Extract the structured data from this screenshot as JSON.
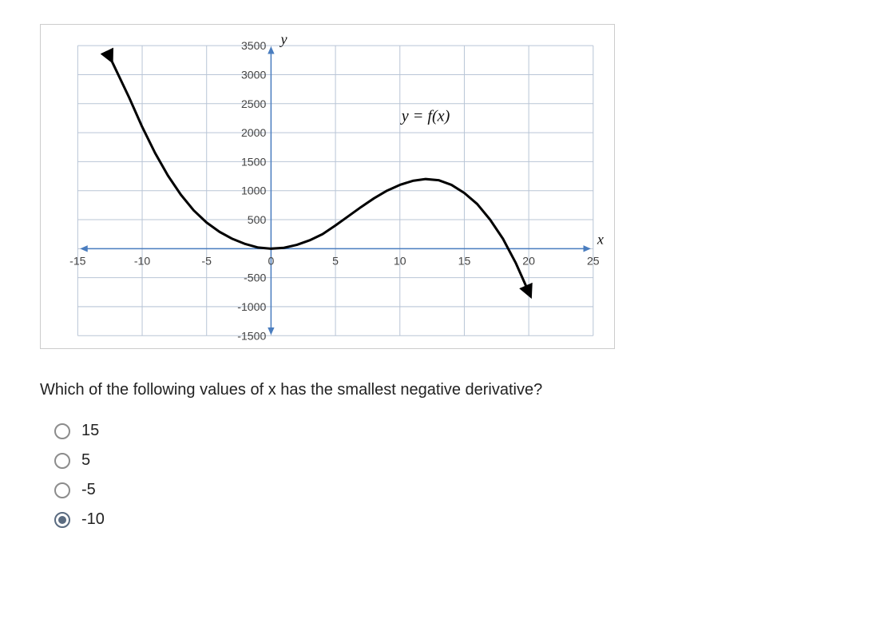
{
  "chart_data": {
    "type": "line",
    "title": "",
    "equation_label": "y = f(x)",
    "xlabel": "x",
    "ylabel": "y",
    "xlim": [
      -15,
      25
    ],
    "ylim": [
      -1500,
      3500
    ],
    "x_ticks": [
      -15,
      -10,
      -5,
      0,
      5,
      10,
      15,
      20,
      25
    ],
    "y_ticks": [
      -1500,
      -1000,
      -500,
      500,
      1000,
      1500,
      2000,
      2500,
      3000,
      3500
    ],
    "series": [
      {
        "name": "f(x)",
        "x": [
          -12.5,
          -11,
          -10,
          -9,
          -8,
          -7,
          -6,
          -5,
          -4,
          -3,
          -2,
          -1,
          0,
          1,
          2,
          3,
          4,
          5,
          6,
          7,
          8,
          9,
          10,
          11,
          12,
          13,
          14,
          15,
          16,
          17,
          18,
          19,
          20
        ],
        "values": [
          3300,
          2600,
          2100,
          1650,
          1260,
          930,
          660,
          450,
          290,
          170,
          80,
          20,
          0,
          15,
          65,
          145,
          250,
          400,
          560,
          720,
          870,
          1000,
          1100,
          1170,
          1200,
          1180,
          1100,
          960,
          770,
          500,
          170,
          -250,
          -750
        ]
      }
    ]
  },
  "question": "Which of the following values of x has the smallest negative derivative?",
  "options": [
    {
      "label": "15",
      "selected": false
    },
    {
      "label": "5",
      "selected": false
    },
    {
      "label": "-5",
      "selected": false
    },
    {
      "label": "-10",
      "selected": true
    }
  ]
}
